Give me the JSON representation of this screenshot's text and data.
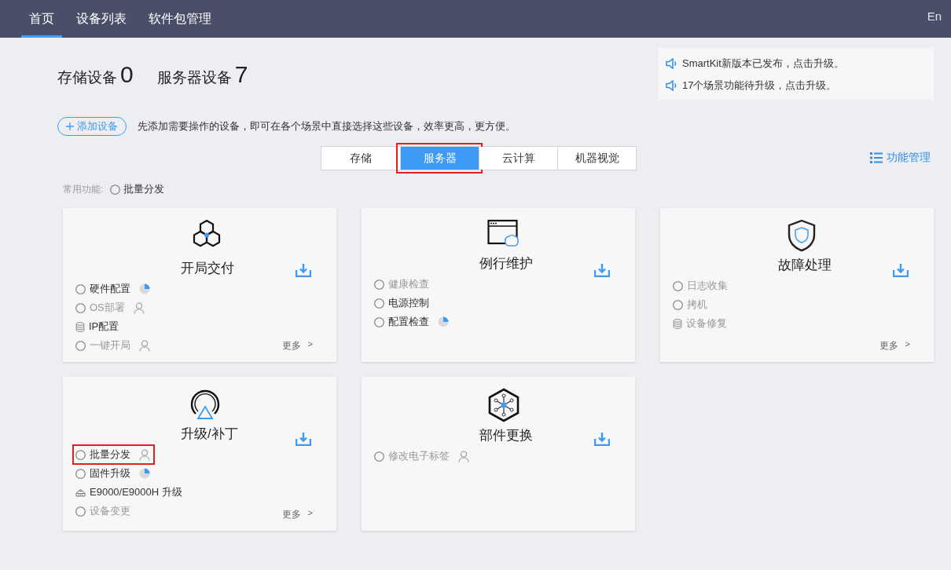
{
  "nav": {
    "items": [
      {
        "label": "首页",
        "selected": true
      },
      {
        "label": "设备列表",
        "selected": false
      },
      {
        "label": "软件包管理",
        "selected": false
      }
    ],
    "lang": "En"
  },
  "stats": [
    {
      "label": "存储设备",
      "value": "0"
    },
    {
      "label": "服务器设备",
      "value": "7"
    }
  ],
  "notices": [
    "SmartKit新版本已发布，点击升级。",
    "17个场景功能待升级，点击升级。"
  ],
  "add_button": "添加设备",
  "hint": "先添加需要操作的设备，即可在各个场景中直接选择这些设备，效率更高，更方便。",
  "tabs": [
    {
      "label": "存储",
      "selected": false,
      "highlighted": false
    },
    {
      "label": "服务器",
      "selected": true,
      "highlighted": true
    },
    {
      "label": "云计算",
      "selected": false,
      "highlighted": false
    },
    {
      "label": "机器视觉",
      "selected": false,
      "highlighted": false
    }
  ],
  "manage_link": "功能管理",
  "common": {
    "label": "常用功能:",
    "items": [
      {
        "label": "批量分发"
      }
    ]
  },
  "cards": [
    {
      "title": "开局交付",
      "more": "更多",
      "more_arrow": ">",
      "items": [
        {
          "label": "硬件配置",
          "kind": "radio",
          "disabled": false,
          "progress": true,
          "user": false,
          "highlighted": false
        },
        {
          "label": "OS部署",
          "kind": "radio",
          "disabled": true,
          "progress": false,
          "user": true,
          "highlighted": false
        },
        {
          "label": "IP配置",
          "kind": "stack",
          "disabled": false,
          "progress": false,
          "user": false,
          "highlighted": false
        },
        {
          "label": "一键开局",
          "kind": "radio",
          "disabled": true,
          "progress": false,
          "user": true,
          "highlighted": false
        }
      ]
    },
    {
      "title": "例行维护",
      "items": [
        {
          "label": "健康检查",
          "kind": "radio",
          "disabled": true,
          "progress": false,
          "user": false,
          "highlighted": false
        },
        {
          "label": "电源控制",
          "kind": "radio",
          "disabled": false,
          "progress": false,
          "user": false,
          "highlighted": false
        },
        {
          "label": "配置检查",
          "kind": "radio",
          "disabled": false,
          "progress": true,
          "user": false,
          "highlighted": false
        }
      ]
    },
    {
      "title": "故障处理",
      "more": "更多",
      "more_arrow": ">",
      "items": [
        {
          "label": "日志收集",
          "kind": "radio",
          "disabled": true,
          "progress": false,
          "user": false,
          "highlighted": false
        },
        {
          "label": "拷机",
          "kind": "radio",
          "disabled": true,
          "progress": false,
          "user": false,
          "highlighted": false
        },
        {
          "label": "设备修复",
          "kind": "stack",
          "disabled": true,
          "progress": false,
          "user": false,
          "highlighted": false
        }
      ]
    },
    {
      "title": "升级/补丁",
      "more": "更多",
      "more_arrow": ">",
      "items": [
        {
          "label": "批量分发",
          "kind": "radio",
          "disabled": false,
          "progress": false,
          "user": true,
          "highlighted": true
        },
        {
          "label": "固件升级",
          "kind": "radio",
          "disabled": false,
          "progress": true,
          "user": false,
          "highlighted": false
        },
        {
          "label": "E9000/E9000H 升级",
          "kind": "chassis",
          "disabled": false,
          "progress": false,
          "user": false,
          "highlighted": false
        },
        {
          "label": "设备变更",
          "kind": "radio",
          "disabled": true,
          "progress": false,
          "user": false,
          "highlighted": false
        }
      ]
    },
    {
      "title": "部件更换",
      "items": [
        {
          "label": "修改电子标签",
          "kind": "radio",
          "disabled": true,
          "progress": false,
          "user": true,
          "highlighted": false
        }
      ]
    }
  ]
}
